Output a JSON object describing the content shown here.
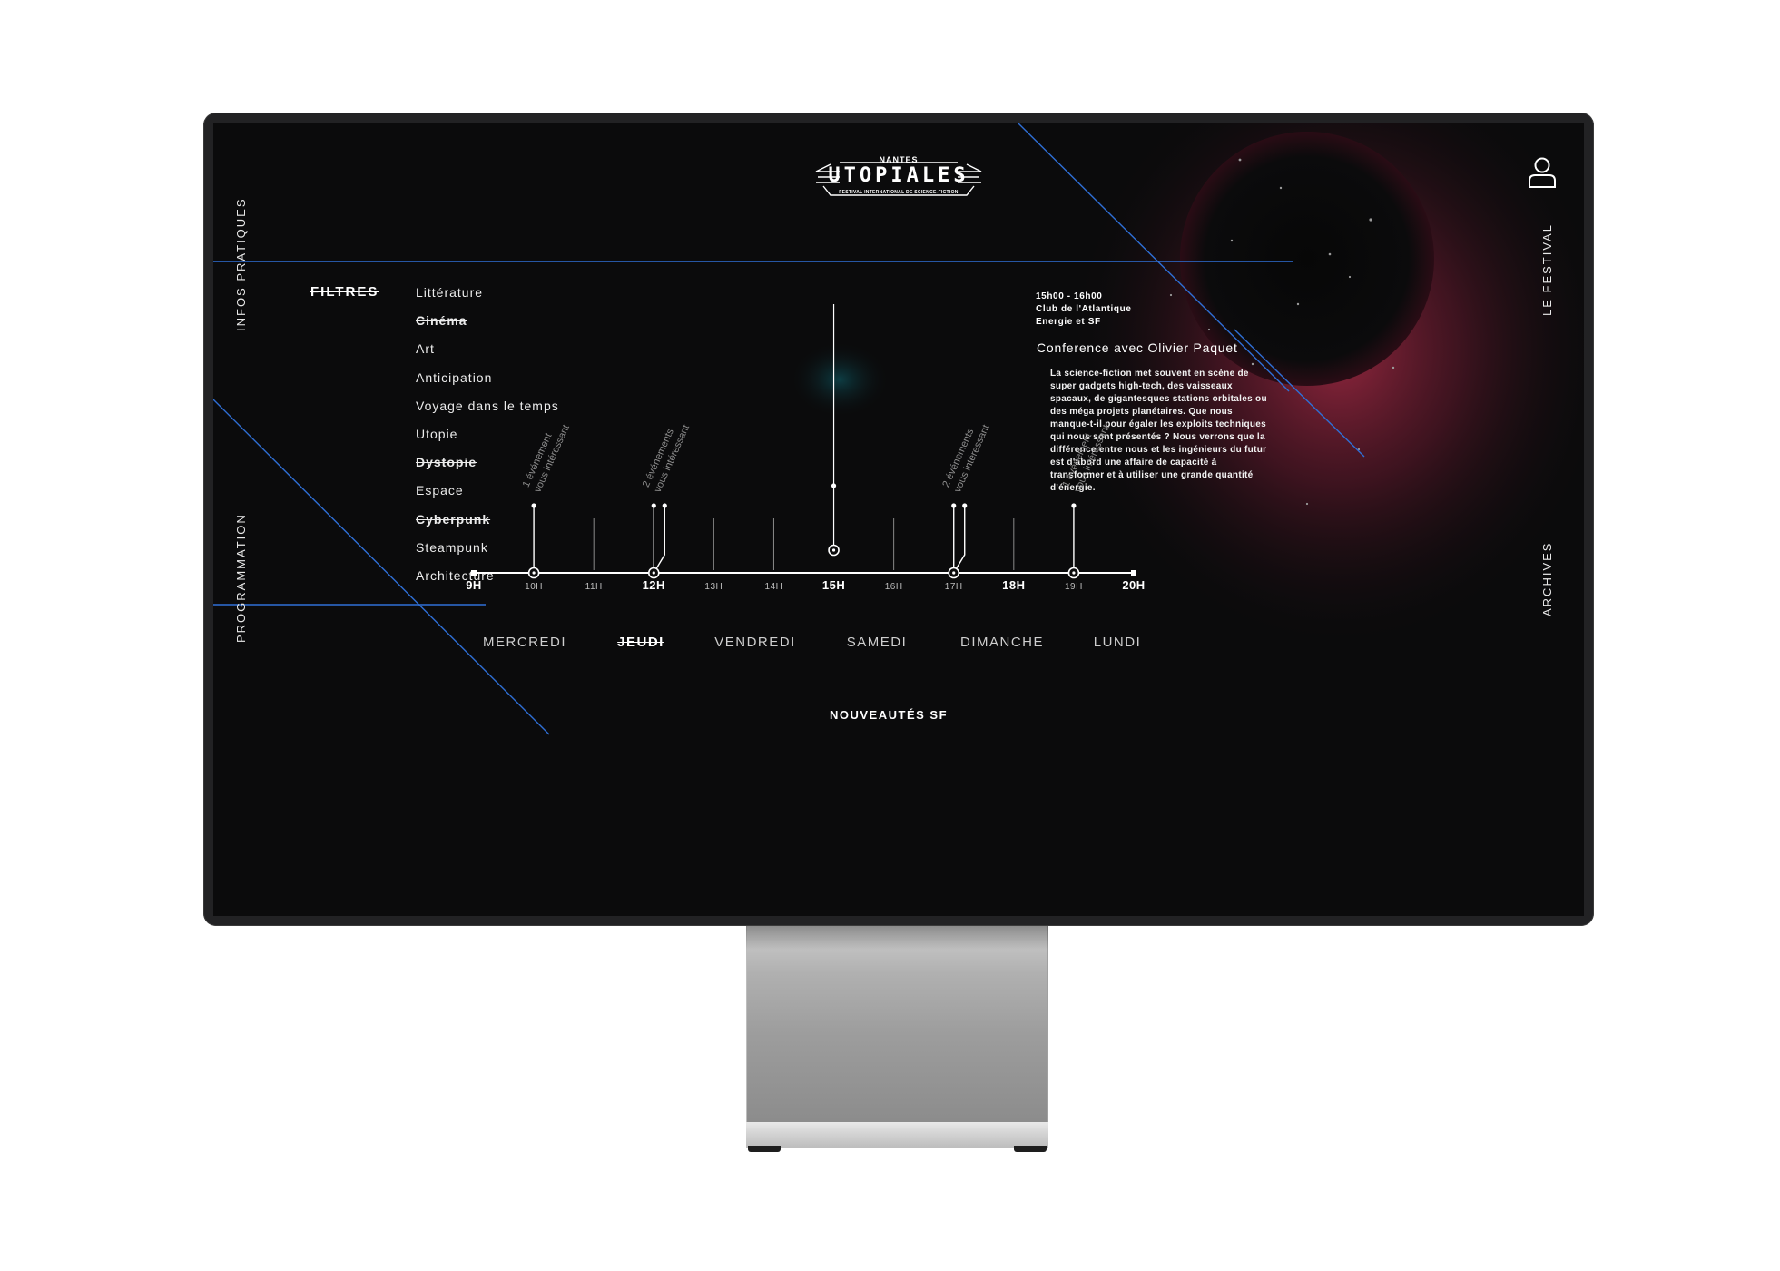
{
  "logo": {
    "top": "NANTES",
    "name": "UTOPIALES",
    "tagline": "FESTIVAL INTERNATIONAL DE SCIENCE-FICTION"
  },
  "nav": {
    "infos": "INFOS PRATIQUES",
    "programmation": "PROGRAMMATION",
    "festival": "LE FESTIVAL",
    "archives": "ARCHIVES"
  },
  "icons": {
    "user": "user-icon"
  },
  "filters": {
    "title": "FILTRES",
    "items": [
      {
        "label": "Littérature",
        "active": true
      },
      {
        "label": "Cinéma",
        "active": false
      },
      {
        "label": "Art",
        "active": true
      },
      {
        "label": "Anticipation",
        "active": true
      },
      {
        "label": "Voyage dans le temps",
        "active": true
      },
      {
        "label": "Utopie",
        "active": true
      },
      {
        "label": "Dystopie",
        "active": false
      },
      {
        "label": "Espace",
        "active": true
      },
      {
        "label": "Cyberpunk",
        "active": false
      },
      {
        "label": "Steampunk",
        "active": true
      },
      {
        "label": "Architecture",
        "active": true
      }
    ]
  },
  "event": {
    "time": "15h00 - 16h00",
    "place": "Club de l'Atlantique",
    "theme": "Energie et SF",
    "title": "Conference avec Olivier Paquet",
    "description": "La science-fiction met souvent en scène de super gadgets high-tech, des vaisseaux spacaux, de gigantesques stations orbitales ou des méga projets planétaires. Que nous manque-t-il pour égaler les exploits techniques qui nous sont présentés ? Nous verrons que la différence entre nous et les ingénieurs du futur est d'abord une affaire de capacité à transformer et à utiliser une grande quantité d'énergie."
  },
  "timeline": {
    "hours": [
      {
        "label": "9H",
        "major": true
      },
      {
        "label": "10H",
        "major": false
      },
      {
        "label": "11H",
        "major": false
      },
      {
        "label": "12H",
        "major": true
      },
      {
        "label": "13H",
        "major": false
      },
      {
        "label": "14H",
        "major": false
      },
      {
        "label": "15H",
        "major": true
      },
      {
        "label": "16H",
        "major": false
      },
      {
        "label": "17H",
        "major": false
      },
      {
        "label": "18H",
        "major": true
      },
      {
        "label": "19H",
        "major": false
      },
      {
        "label": "20H",
        "major": true
      }
    ],
    "clusters": [
      {
        "hour": "10H",
        "count": 1,
        "line1": "1 événement",
        "line2": "vous intéressant"
      },
      {
        "hour": "12H",
        "count": 2,
        "line1": "2 événements",
        "line2": "vous intéressant"
      },
      {
        "hour": "17H",
        "count": 2,
        "line1": "2 événements",
        "line2": "vous intéressant"
      },
      {
        "hour": "19H",
        "count": 1,
        "line1": "1 événement",
        "line2": "vous intéressant"
      }
    ],
    "selected_hour": "15H"
  },
  "days": [
    {
      "label": "MERCREDI",
      "active": false
    },
    {
      "label": "JEUDI",
      "active": true
    },
    {
      "label": "VENDREDI",
      "active": false
    },
    {
      "label": "SAMEDI",
      "active": false
    },
    {
      "label": "DIMANCHE",
      "active": false
    },
    {
      "label": "LUNDI",
      "active": false
    }
  ],
  "footer": {
    "link": "NOUVEAUTÉS SF"
  },
  "colors": {
    "background": "#0b0b0c",
    "accent_blue": "#2f6fd6",
    "nebula": "#b02a4a",
    "text": "#ffffff"
  }
}
